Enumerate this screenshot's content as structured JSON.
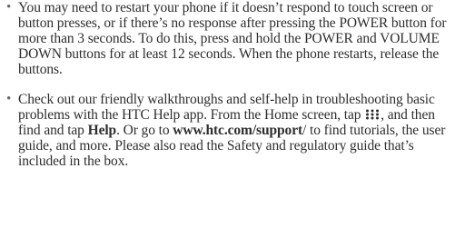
{
  "bullets": [
    {
      "marker": "•",
      "text": "You may need to restart your phone if it doesn’t respond to touch screen or button presses, or if there’s no response after pressing the POWER button for more than 3 seconds. To do this, press and hold the POWER and VOLUME DOWN buttons for at least 12 seconds. When the phone restarts, release the buttons."
    },
    {
      "marker": "•",
      "part1": "Check out our friendly walkthroughs and self-help in troubleshooting basic problems with the HTC Help app. From the Home screen, tap ",
      "icon": "apps-grid-icon",
      "part2": ", and then find and tap ",
      "bold1": "Help",
      "part3": ". Or go to ",
      "bold2": "www.htc.com/support",
      "part4": "/ to find tutorials, the user guide, and more. Please also read the Safety and regulatory guide that’s included in the box."
    }
  ],
  "colors": {
    "text": "#2e2e2e",
    "bullet": "#6a6a6a"
  }
}
